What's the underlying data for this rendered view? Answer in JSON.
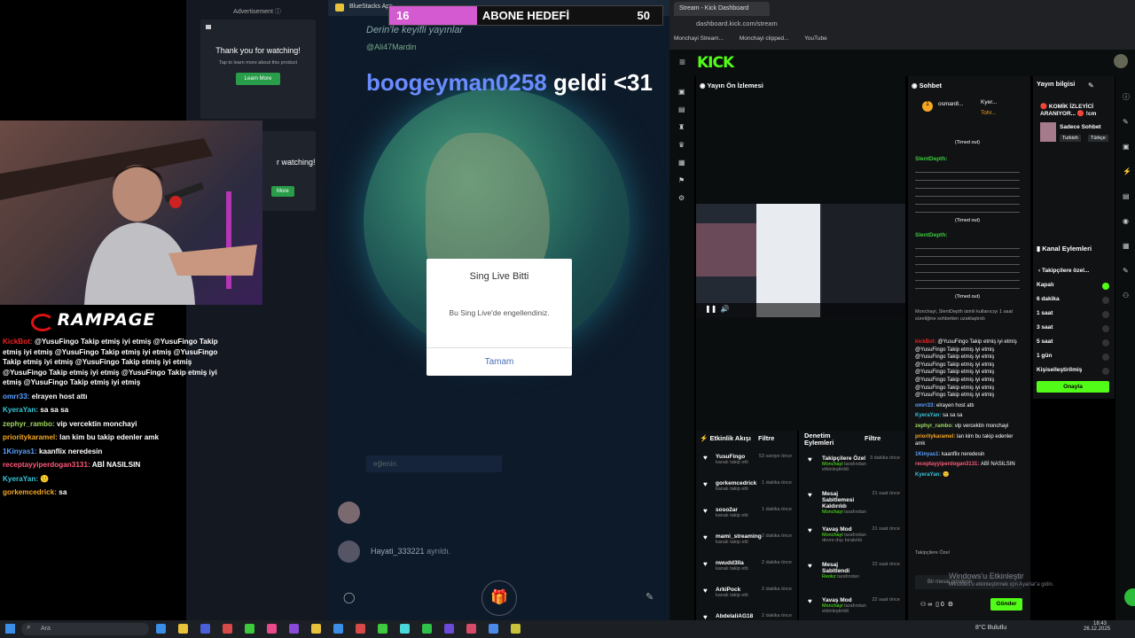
{
  "advertisement": {
    "label": "Advertisement ⓘ",
    "title": "Thank you for watching!",
    "subtitle": "Tap to learn more about this product",
    "button": "Learn More",
    "title2": "r watching!",
    "button2": "More"
  },
  "overlay": {
    "brand": "RAMPAGE",
    "chat": [
      {
        "user": "KickBot:",
        "color": "u-red",
        "msg": "@YusuFingo Takip etmiş iyi etmiş @YusuFingo Takip etmiş iyi etmiş @YusuFingo Takip etmiş iyi etmiş @YusuFingo Takip etmiş iyi etmiş @YusuFingo Takip etmiş iyi etmiş @YusuFingo Takip etmiş iyi etmiş @YusuFingo Takip etmiş iyi etmiş @YusuFingo Takip etmiş iyi etmiş"
      },
      {
        "user": "omrr33:",
        "color": "u-blue",
        "msg": "elrayen host attı"
      },
      {
        "user": "KyeraYan:",
        "color": "u-cyan",
        "msg": "sa sa sa"
      },
      {
        "user": "zephyr_rambo:",
        "color": "u-lime",
        "msg": "vip vercektin monchayi"
      },
      {
        "user": "prioritykaramel:",
        "color": "u-orange",
        "msg": "lan kim bu takip edenler amk"
      },
      {
        "user": "1Kinyas1:",
        "color": "u-blue",
        "msg": "kaanflix neredesin"
      },
      {
        "user": "receptayyiperdogan3131:",
        "color": "u-pink",
        "msg": "ABİ NASILSIN"
      },
      {
        "user": "KyeraYan:",
        "color": "u-cyan",
        "msg": "🙂"
      },
      {
        "user": "gorkemcedrick:",
        "color": "u-orange",
        "msg": "sa"
      }
    ]
  },
  "bluestacks": {
    "title": "BlueStacks App",
    "goal": {
      "current": "16",
      "label": "ABONE HEDEFİ",
      "target": "50",
      "progress": 0.32
    },
    "ribbon": "Derin'le keyifli yayınlar",
    "mention": "@Ali47Mardin",
    "welcome_name": "boogeyman0258",
    "welcome_text": " geldi <31",
    "dialog": {
      "title": "Sing Live Bitti",
      "body": "Bu Sing Live'de engellendiniz.",
      "ok": "Tamam"
    },
    "input_placeholder": "eğlenin.",
    "leave_user": "Hayati_333221",
    "leave_text": " ayrıldı."
  },
  "browser": {
    "tab": "Stream - Kick Dashboard",
    "url": "dashboard.kick.com/stream",
    "bookmarks": [
      "Monchayi Stream...",
      "Monchayi clipped...",
      "YouTube"
    ]
  },
  "kick": {
    "logo": "KICK",
    "preview_title": "Yayın Ön İzlemesi",
    "events_title": "Etkinlik Akışı",
    "filter": "Filtre",
    "mod_title": "Denetim Eylemleri",
    "events": [
      {
        "name": "YusuFingo",
        "desc": "kanalı takip etti",
        "time": "53 saniye önce"
      },
      {
        "name": "gorkemcedrick",
        "desc": "kanalı takip etti",
        "time": "1 dakika önce"
      },
      {
        "name": "soso2ar",
        "desc": "kanalı takip etti",
        "time": "1 dakika önce"
      },
      {
        "name": "mami_streaming",
        "desc": "kanalı takip etti",
        "time": "2 dakika önce"
      },
      {
        "name": "nwudd3lla",
        "desc": "kanalı takip etti",
        "time": "2 dakika önce"
      },
      {
        "name": "ArkiPock",
        "desc": "kanalı takip etti",
        "time": "2 dakika önce"
      },
      {
        "name": "AbdelaliAG18",
        "desc": "",
        "time": "2 dakika önce"
      }
    ],
    "mod_actions": [
      {
        "name": "Takipçilere Özel",
        "by": "Monchayi",
        "desc": "tarafından etkinleştirildi",
        "time": "3 dakika önce"
      },
      {
        "name": "Mesaj Sabitlemesi Kaldırıldı",
        "by": "Monchayi",
        "desc": "tarafından",
        "time": "21 saat önce"
      },
      {
        "name": "Yavaş Mod",
        "by": "Monchayi",
        "desc": "tarafından devre dışı bırakıldı",
        "time": "21 saat önce"
      },
      {
        "name": "Mesaj Sabitlendi",
        "by": "Reokz",
        "desc": "tarafından",
        "time": "22 saat önce"
      },
      {
        "name": "Yavaş Mod",
        "by": "Monchayi",
        "desc": "tarafından etkinleştirildi",
        "time": "22 saat önce"
      }
    ],
    "chat_title": "Sohbet",
    "top_users": [
      "osman8...",
      "Kyer...",
      "Tohr..."
    ],
    "timed_out": "(Timed out)",
    "silent_user": "SlentDepth:",
    "timeout_notice": "Monchayi, SlentDepth isimli kullanıcıyı 1 saat süreliğine sohbetten uzaklaştırdı",
    "chat_lines": [
      {
        "user": "kickBot:",
        "color": "u-red",
        "msg": "@YusuFingo Takip etmiş iyi etmiş @YusuFingo Takip etmiş iyi etmiş @YusuFingo Takip etmiş iyi etmiş @YusuFingo Takip etmiş iyi etmiş @YusuFingo Takip etmiş iyi etmiş @YusuFingo Takip etmiş iyi etmiş @YusuFingo Takip etmiş iyi etmiş @YusuFingo Takip etmiş iyi etmiş"
      },
      {
        "user": "omrr33:",
        "color": "u-blue",
        "msg": "elrayen host attı"
      },
      {
        "user": "KyeraYan:",
        "color": "u-cyan",
        "msg": "sa sa sa"
      },
      {
        "user": "zephyr_rambo:",
        "color": "u-lime",
        "msg": "vip vercektin monchayi"
      },
      {
        "user": "prioritykaramel:",
        "color": "u-orange",
        "msg": "lan kim bu takip edenler amk"
      },
      {
        "user": "1Kinyas1:",
        "color": "u-blue",
        "msg": "kaanflix neredesin"
      },
      {
        "user": "receptayyiperdogan3131:",
        "color": "u-pink",
        "msg": "ABİ NASILSIN"
      },
      {
        "user": "KyeraYan:",
        "color": "u-cyan",
        "msg": "🙂"
      }
    ],
    "followers_only": "Takipçilere Özel",
    "message_placeholder": "Bir mesaj gönderin",
    "send": "Gönder",
    "stream_info": "Yayın bilgisi",
    "stream_title": "🔴 KOMİK İZLEYİCİ ARANIYOR... 🔴 !cm",
    "category": "Sadece Sohbet",
    "tags": [
      "Turkish",
      "Türkçe"
    ],
    "channel_actions": "Kanal Eylemleri",
    "followers_mode": "Takipçilere özel...",
    "options": [
      "Kapalı",
      "6 dakika",
      "1 saat",
      "3 saat",
      "5 saat",
      "1 gün",
      "Kişiselleştirilmiş"
    ],
    "approve": "Onayla",
    "counts": {
      "a": "0",
      "b": "0"
    }
  },
  "windows": {
    "watermark": "Windows'u Etkinleştir",
    "watermark_sub": "Windows'u etkinleştirmek için Ayarlar'a gidin."
  },
  "taskbar": {
    "search": "Ara",
    "weather": "8°C Bulutlu",
    "time": "18:43",
    "date": "26.12.2025"
  }
}
